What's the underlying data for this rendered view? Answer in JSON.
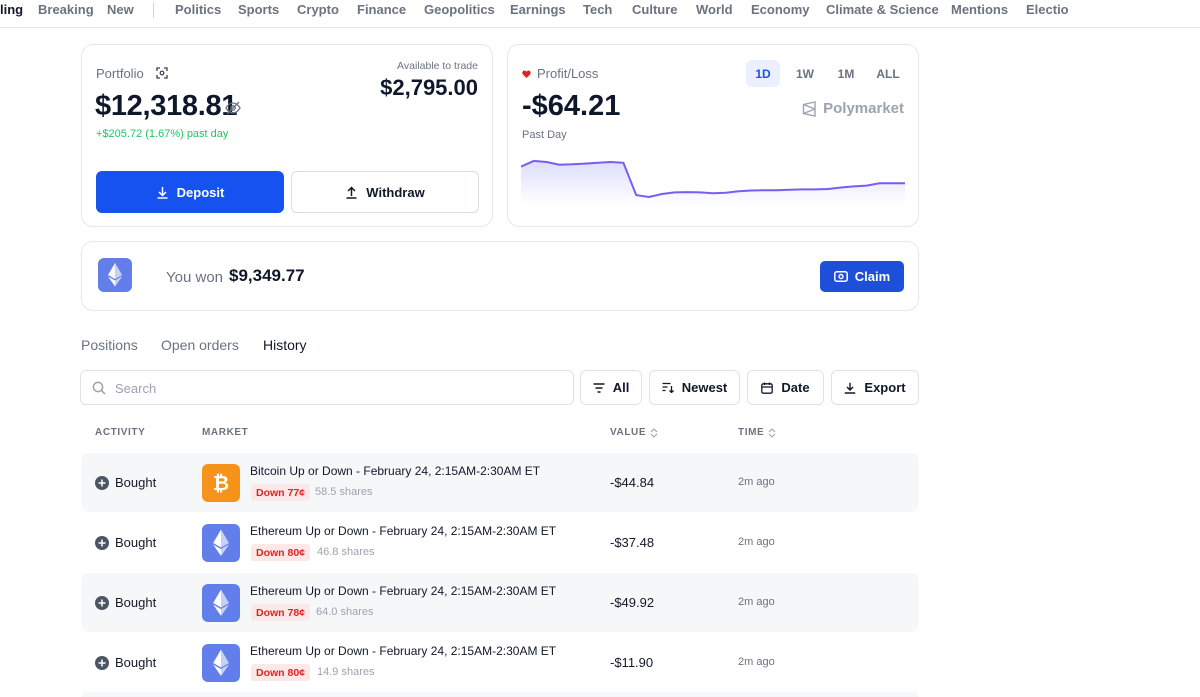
{
  "nav": {
    "items": [
      "ling",
      "Breaking",
      "New",
      "Politics",
      "Sports",
      "Crypto",
      "Finance",
      "Geopolitics",
      "Earnings",
      "Tech",
      "Culture",
      "World",
      "Economy",
      "Climate & Science",
      "Mentions",
      "Electio"
    ]
  },
  "portfolio": {
    "label": "Portfolio",
    "value": "$12,318.81",
    "change": "+$205.72 (1.67%) past day",
    "available_label": "Available to trade",
    "available_value": "$2,795.00",
    "deposit_label": "Deposit",
    "withdraw_label": "Withdraw"
  },
  "pnl": {
    "label": "Profit/Loss",
    "value": "-$64.21",
    "period_label": "Past Day",
    "ranges": [
      "1D",
      "1W",
      "1M",
      "ALL"
    ],
    "active_range": "1D",
    "brand": "Polymarket",
    "line_color": "#7c5cf0",
    "series": [
      0.8,
      0.95,
      0.92,
      0.85,
      0.86,
      0.88,
      0.9,
      0.92,
      0.9,
      0.05,
      0.0,
      0.08,
      0.12,
      0.13,
      0.12,
      0.1,
      0.11,
      0.15,
      0.17,
      0.18,
      0.18,
      0.19,
      0.2,
      0.2,
      0.21,
      0.25,
      0.28,
      0.3,
      0.36,
      0.36,
      0.36
    ]
  },
  "won": {
    "label": "You won",
    "amount": "$9,349.77",
    "claim_label": "Claim"
  },
  "tabs": [
    "Positions",
    "Open orders",
    "History"
  ],
  "active_tab": "History",
  "search": {
    "placeholder": "Search",
    "value": ""
  },
  "filters": {
    "all": "All",
    "sort": "Newest",
    "date": "Date",
    "export": "Export"
  },
  "table": {
    "headers": {
      "activity": "ACTIVITY",
      "market": "MARKET",
      "value": "VALUE",
      "time": "TIME"
    },
    "rows": [
      {
        "activity": "Bought",
        "coin": "bitcoin",
        "market": "Bitcoin Up or Down - February 24, 2:15AM-2:30AM ET",
        "badge": "Down 77¢",
        "shares": "58.5 shares",
        "value": "-$44.84",
        "time": "2m ago"
      },
      {
        "activity": "Bought",
        "coin": "ethereum",
        "market": "Ethereum Up or Down - February 24, 2:15AM-2:30AM ET",
        "badge": "Down 80¢",
        "shares": "46.8 shares",
        "value": "-$37.48",
        "time": "2m ago"
      },
      {
        "activity": "Bought",
        "coin": "ethereum",
        "market": "Ethereum Up or Down - February 24, 2:15AM-2:30AM ET",
        "badge": "Down 78¢",
        "shares": "64.0 shares",
        "value": "-$49.92",
        "time": "2m ago"
      },
      {
        "activity": "Bought",
        "coin": "ethereum",
        "market": "Ethereum Up or Down - February 24, 2:15AM-2:30AM ET",
        "badge": "Down 80¢",
        "shares": "14.9 shares",
        "value": "-$11.90",
        "time": "2m ago"
      }
    ]
  },
  "colors": {
    "primary": "#1652f0",
    "positive": "#22c55e",
    "negative": "#e02424",
    "bitcoin": "#f7931a",
    "ethereum": "#627eea"
  }
}
